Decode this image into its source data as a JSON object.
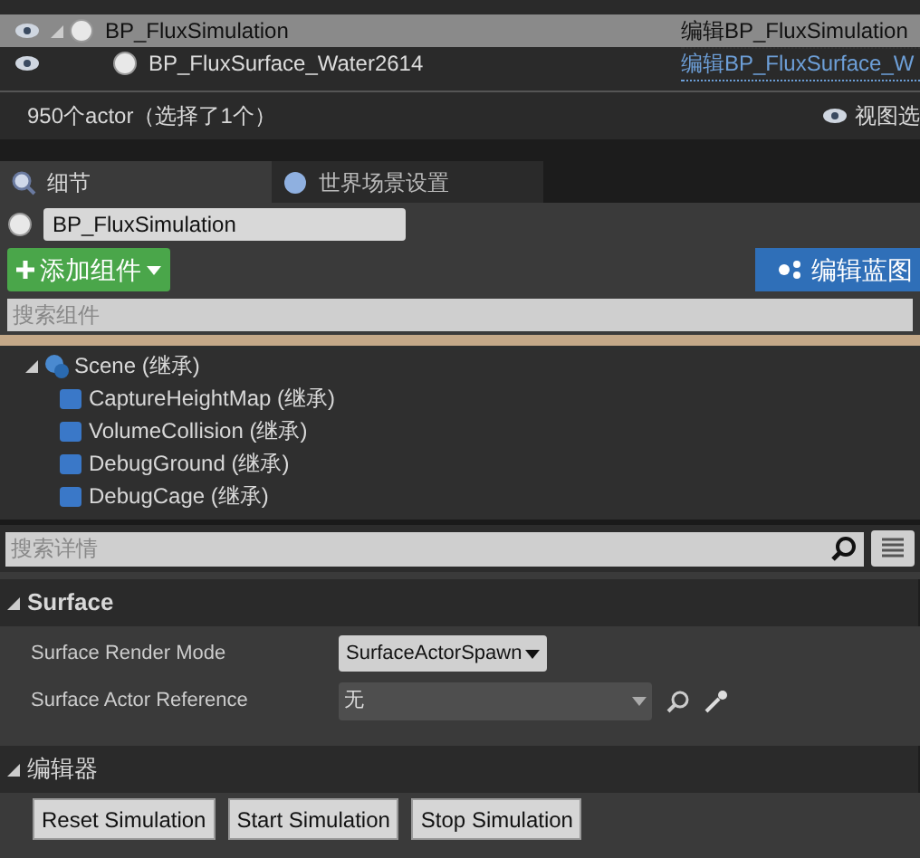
{
  "outliner": {
    "rows": [
      {
        "name": "BP_FluxSimulation",
        "type_link": "编辑BP_FluxSimulation",
        "selected": true,
        "expanded": true
      },
      {
        "name": "BP_FluxSurface_Water2614",
        "type_link": "编辑BP_FluxSurface_W",
        "selected": false
      }
    ],
    "status": "950个actor（选择了1个）",
    "view_options": "视图选"
  },
  "tabs": [
    {
      "label": "细节",
      "selected": true
    },
    {
      "label": "世界场景设置",
      "selected": false
    }
  ],
  "actor_name": "BP_FluxSimulation",
  "add_component": "添加组件",
  "edit_blueprint": "编辑蓝图",
  "component_search": {
    "placeholder": "搜索组件"
  },
  "components": [
    {
      "label": "Scene (继承)",
      "expanded": true,
      "children": [
        {
          "label": "CaptureHeightMap (继承)"
        },
        {
          "label": "VolumeCollision (继承)"
        },
        {
          "label": "DebugGround (继承)"
        },
        {
          "label": "DebugCage (继承)"
        }
      ]
    }
  ],
  "details_search": {
    "placeholder": "搜索详情"
  },
  "categories": [
    {
      "title": "Surface",
      "expanded": true,
      "properties": [
        {
          "kind": "combo",
          "label": "Surface Render Mode",
          "value": "SurfaceActorSpawn"
        },
        {
          "kind": "picker",
          "label": "Surface Actor Reference",
          "value": "无"
        }
      ]
    },
    {
      "title": "编辑器",
      "expanded": true,
      "buttons": [
        "Reset Simulation",
        "Start Simulation",
        "Stop Simulation"
      ]
    }
  ]
}
